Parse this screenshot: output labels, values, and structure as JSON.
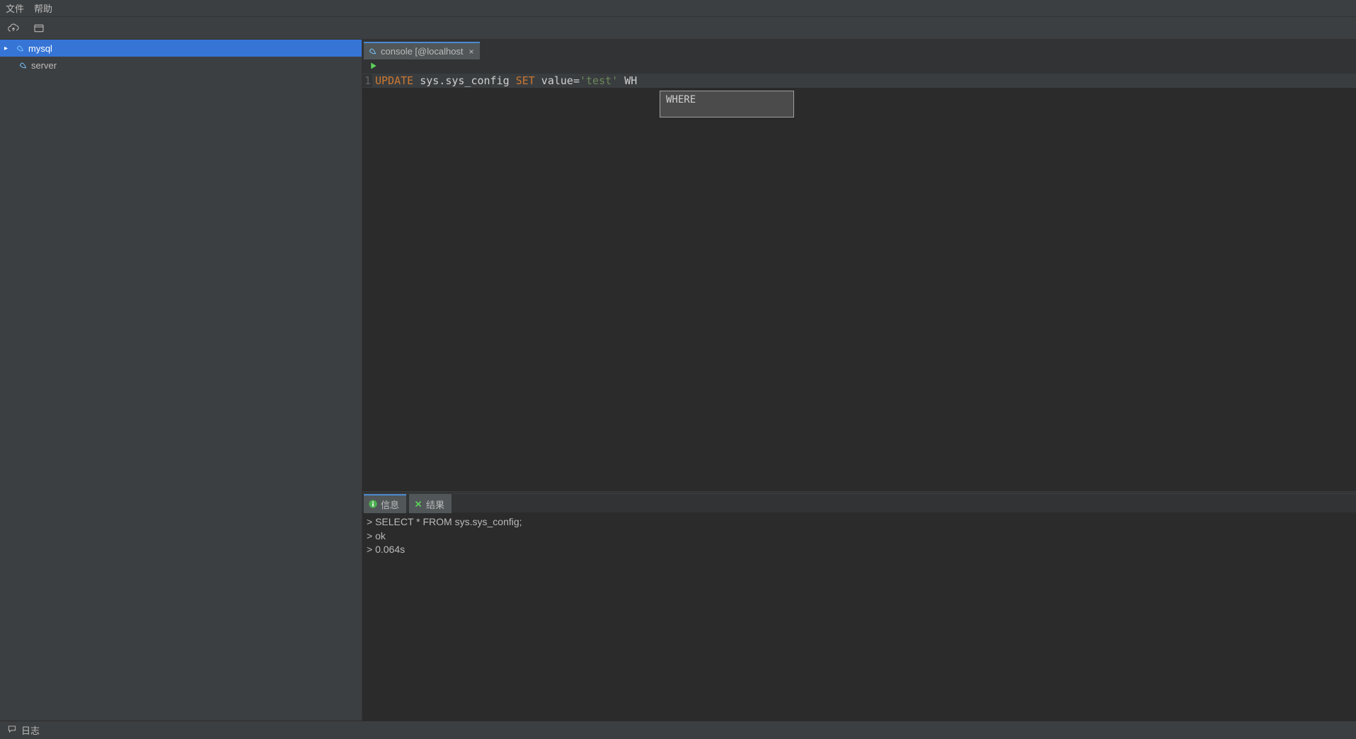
{
  "menu": {
    "file": "文件",
    "help": "帮助"
  },
  "sidebar": {
    "items": [
      {
        "label": "mysql"
      },
      {
        "label": "server"
      }
    ]
  },
  "editor": {
    "tab_label": "console [@localhost",
    "line_number": "1",
    "sql": {
      "kw_update": "UPDATE",
      "table": " sys.sys_config ",
      "kw_set": "SET",
      "assign": " value=",
      "string": "'test'",
      "tail": " WH"
    },
    "autocomplete": {
      "item": "WHERE"
    }
  },
  "results": {
    "tabs": {
      "info": "信息",
      "result": "结果"
    },
    "lines": [
      "> SELECT * FROM sys.sys_config;",
      "> ok",
      "> 0.064s"
    ]
  },
  "status": {
    "log": "日志"
  }
}
